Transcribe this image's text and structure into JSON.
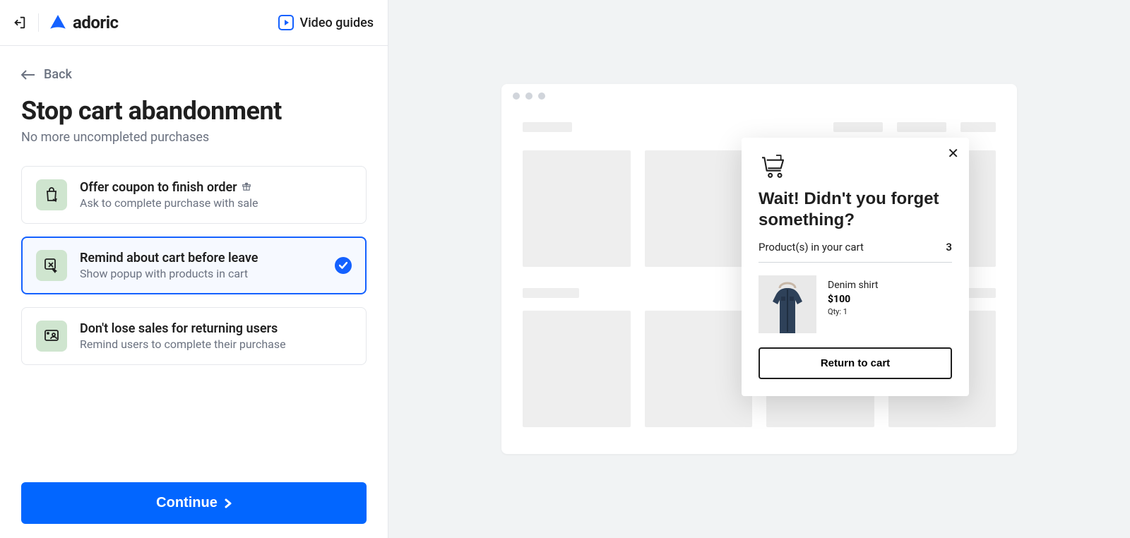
{
  "header": {
    "brand": "adoric",
    "video_guides_label": "Video guides"
  },
  "back_label": "Back",
  "page_title": "Stop cart abandonment",
  "page_subtitle": "No more uncompleted purchases",
  "options": [
    {
      "title": "Offer coupon to finish order",
      "desc": "Ask to complete purchase with sale"
    },
    {
      "title": "Remind about cart before leave",
      "desc": "Show popup with products in cart"
    },
    {
      "title": "Don't lose sales for returning users",
      "desc": "Remind users to complete their purchase"
    }
  ],
  "continue_label": "Continue",
  "popup": {
    "heading": "Wait! Didn't you forget something?",
    "cart_label": "Product(s) in your cart",
    "cart_count": "3",
    "product": {
      "name": "Denim shirt",
      "price": "$100",
      "qty": "Qty: 1"
    },
    "return_label": "Return to cart"
  }
}
